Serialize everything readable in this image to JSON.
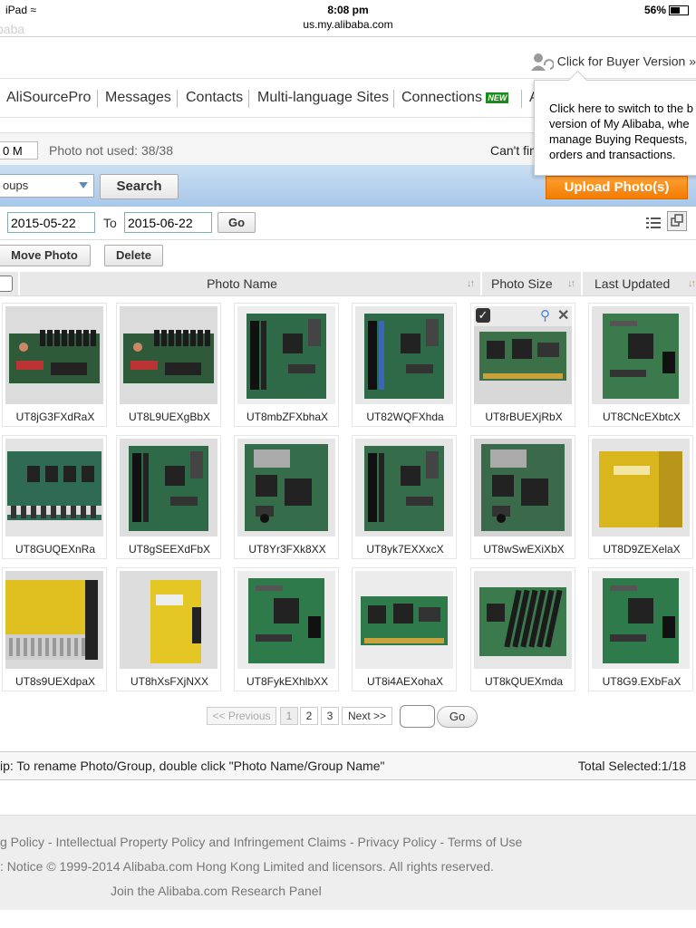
{
  "status_bar": {
    "device": "iPad",
    "time": "8:08 pm",
    "url": "us.my.alibaba.com",
    "battery": "56%"
  },
  "ghost_logo": "baba",
  "header": {
    "buyer_switch": "Click for Buyer Version »"
  },
  "nav": {
    "items": [
      "AliSourcePro",
      "Messages",
      "Contacts",
      "Multi-language Sites",
      "Connections",
      "A"
    ],
    "new_badge": "NEW"
  },
  "tooltip": {
    "lines": [
      "Click here to switch to the b",
      "version of My Alibaba, whe",
      "manage Buying Requests,",
      "orders and transactions."
    ]
  },
  "info": {
    "space_value": "0 M",
    "photo_not_used": "Photo not used: 38/38",
    "cant_find": "Can't fin"
  },
  "search": {
    "group_select": "oups",
    "search_label": "Search",
    "upload_label": "Upload Photo(s)"
  },
  "dates": {
    "from": "2015-05-22",
    "to_label": "To",
    "to": "2015-06-22",
    "go_label": "Go"
  },
  "actions": {
    "move": "Move Photo",
    "delete": "Delete"
  },
  "table": {
    "col_name": "Photo Name",
    "col_size": "Photo Size",
    "col_updated": "Last Updated"
  },
  "photos": [
    "UT8jG3FXdRaX",
    "UT8L9UEXgBbX",
    "UT8mbZFXbhaX",
    "UT82WQFXhda",
    "UT8rBUEXjRbX",
    "UT8CNcEXbtcX",
    "UT8GUQEXnRa",
    "UT8gSEEXdFbX",
    "UT8Yr3FXk8XX",
    "UT8yk7EXXxcX",
    "UT8wSwEXiXbX",
    "UT8D9ZEXelaX",
    "UT8s9UEXdpaX",
    "UT8hXsFXjNXX",
    "UT8FykEXhlbXX",
    "UT8i4AEXohaX",
    "UT8kQUEXmda",
    "UT8G9.EXbFaX"
  ],
  "pagination": {
    "prev": "<< Previous",
    "pages": [
      "1",
      "2",
      "3"
    ],
    "next": "Next >>",
    "go": "Go"
  },
  "tip": {
    "text": "ip: To rename Photo/Group, double click \"Photo Name/Group Name\"",
    "total": "Total Selected:1/18"
  },
  "footer": {
    "links": "g Policy - Intellectual Property Policy and Infringement Claims - Privacy Policy - Terms of Use",
    "copyright": ": Notice © 1999-2014 Alibaba.com Hong Kong Limited and licensors. All rights reserved.",
    "panel": "Join the Alibaba.com Research Panel"
  },
  "colors": {
    "accent_orange": "#f47c00",
    "search_bar_blue": "#b8d4ef",
    "new_green": "#1a8a1a"
  }
}
